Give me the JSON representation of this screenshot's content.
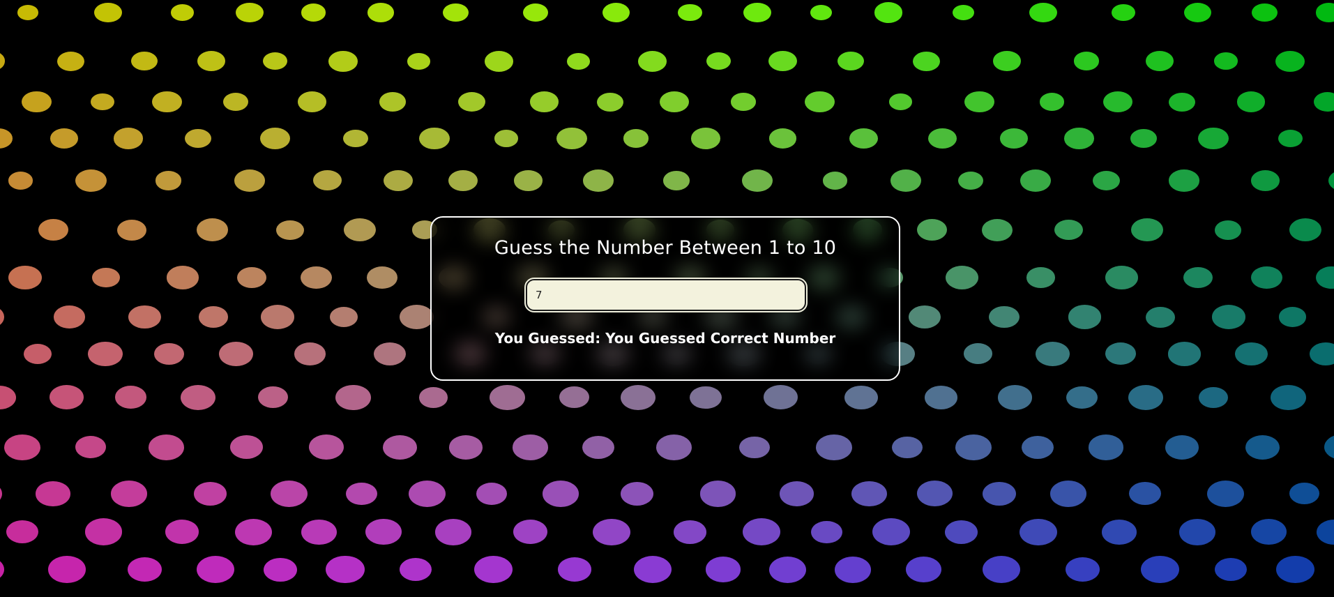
{
  "background": {
    "color": "#000000",
    "pattern": "polka-dot-gradient",
    "dot_colors": {
      "top_left": "#ffee00",
      "top_right": "#00ee11",
      "bottom_left": "#ff22dd",
      "bottom_right": "#1144dd"
    }
  },
  "game": {
    "title": "Guess the Number Between 1 to 10",
    "input_value": "7",
    "result_text": "You Guessed: You Guessed Correct Number"
  }
}
